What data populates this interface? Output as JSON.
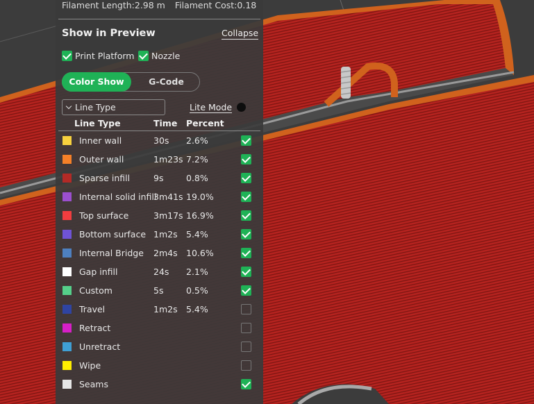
{
  "stats": {
    "filament_length": "Filament Length:2.98 m",
    "filament_cost": "Filament Cost:0.18"
  },
  "preview": {
    "title": "Show in Preview",
    "collapse_label": "Collapse",
    "options": [
      {
        "label": "Print Platform",
        "checked": true
      },
      {
        "label": "Nozzle",
        "checked": true
      }
    ],
    "view_modes": [
      "Color Show",
      "G-Code"
    ],
    "active_mode": "Color Show",
    "dropdown_value": "Line Type",
    "lite_mode_label": "Lite Mode",
    "lite_mode_on": false
  },
  "table": {
    "headers": [
      "Line Type",
      "Time",
      "Percent"
    ],
    "rows": [
      {
        "name": "Inner wall",
        "time": "30s",
        "percent": "2.6%",
        "color": "#f7d13e",
        "checked": true
      },
      {
        "name": "Outer wall",
        "time": "1m23s",
        "percent": "7.2%",
        "color": "#f58028",
        "checked": true
      },
      {
        "name": "Sparse infill",
        "time": "9s",
        "percent": "0.8%",
        "color": "#b22a26",
        "checked": true
      },
      {
        "name": "Internal solid infill",
        "time": "3m41s",
        "percent": "19.0%",
        "color": "#9b4fce",
        "checked": true
      },
      {
        "name": "Top surface",
        "time": "3m17s",
        "percent": "16.9%",
        "color": "#f23d3f",
        "checked": true
      },
      {
        "name": "Bottom surface",
        "time": "1m2s",
        "percent": "5.4%",
        "color": "#6f53d6",
        "checked": true
      },
      {
        "name": "Internal Bridge",
        "time": "2m4s",
        "percent": "10.6%",
        "color": "#4e80c0",
        "checked": true
      },
      {
        "name": "Gap infill",
        "time": "24s",
        "percent": "2.1%",
        "color": "#ffffff",
        "checked": true
      },
      {
        "name": "Custom",
        "time": "5s",
        "percent": "0.5%",
        "color": "#55cf8a",
        "checked": true
      },
      {
        "name": "Travel",
        "time": "1m2s",
        "percent": "5.4%",
        "color": "#2f44a2",
        "checked": false
      },
      {
        "name": "Retract",
        "time": "",
        "percent": "",
        "color": "#d61fc6",
        "checked": false
      },
      {
        "name": "Unretract",
        "time": "",
        "percent": "",
        "color": "#3f9fd4",
        "checked": false
      },
      {
        "name": "Wipe",
        "time": "",
        "percent": "",
        "color": "#ffee00",
        "checked": false
      },
      {
        "name": "Seams",
        "time": "",
        "percent": "",
        "color": "#e6e6e6",
        "checked": true
      }
    ]
  },
  "colors": {
    "accent": "#1fb256",
    "panel_bg": "#3a3a3a",
    "viewport_bg": "#3c3c3c",
    "print_red": "#b5231f",
    "print_orange": "#d0621d"
  }
}
